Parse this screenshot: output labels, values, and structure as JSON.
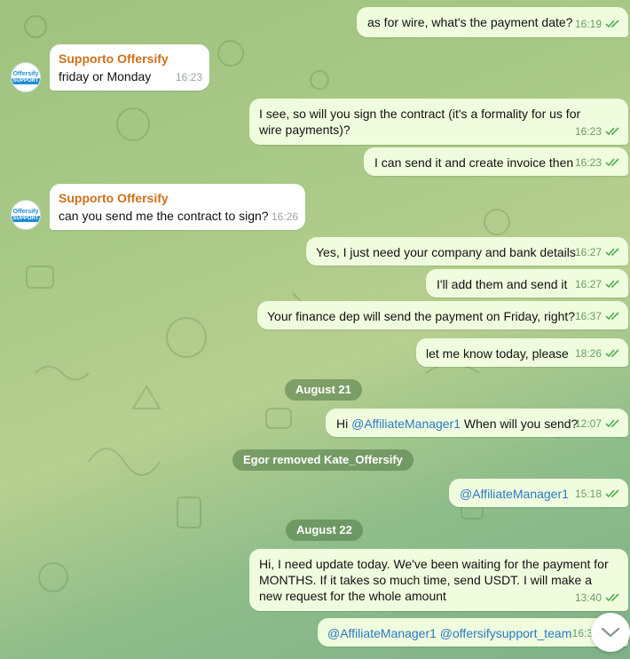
{
  "chat": {
    "contact_name": "Supporto Offersify",
    "avatar_line1": "Offersify",
    "avatar_line2": "SUPPORT"
  },
  "messages": [
    {
      "text": "as for wire, what's the payment date?",
      "time": "16:19"
    },
    {
      "sender": "Supporto Offersify",
      "text": "friday or Monday",
      "time": "16:23"
    },
    {
      "text": "I see, so will you sign the contract (it's a formality for us for wire payments)?",
      "time": "16:23"
    },
    {
      "text": "I can send it and create invoice then",
      "time": "16:23"
    },
    {
      "sender": "Supporto Offersify",
      "text": "can you send me the contract to sign?",
      "time": "16:26"
    },
    {
      "text": "Yes, I just need your company and bank details",
      "time": "16:27"
    },
    {
      "text": "I'll add them and send it",
      "time": "16:27"
    },
    {
      "text": "Your finance dep will send the payment on Friday, right?",
      "time": "16:37"
    },
    {
      "text": "let me know today, please",
      "time": "18:26"
    },
    {
      "prefix": "Hi ",
      "mention": "@AffiliateManager1",
      "suffix": " When will you send?",
      "time": "12:07"
    },
    {
      "mention": "@AffiliateManager1",
      "time": "15:18"
    },
    {
      "text": "Hi, I need update today. We've been waiting for the payment for MONTHS. If it takes so much time, send USDT. I will make a new request for the whole amount",
      "time": "13:40"
    },
    {
      "mention": "@AffiliateManager1 @offersifysupport_team",
      "time": "16:3"
    }
  ],
  "dates": [
    "August 21",
    "August 22"
  ],
  "service": {
    "removed": "Egor removed Kate_Offersify"
  },
  "colors": {
    "outgoing": "#effdde",
    "incoming": "#ffffff",
    "sender": "#d0701a",
    "mention": "#2c78c4",
    "time_out": "#6b9b66"
  }
}
